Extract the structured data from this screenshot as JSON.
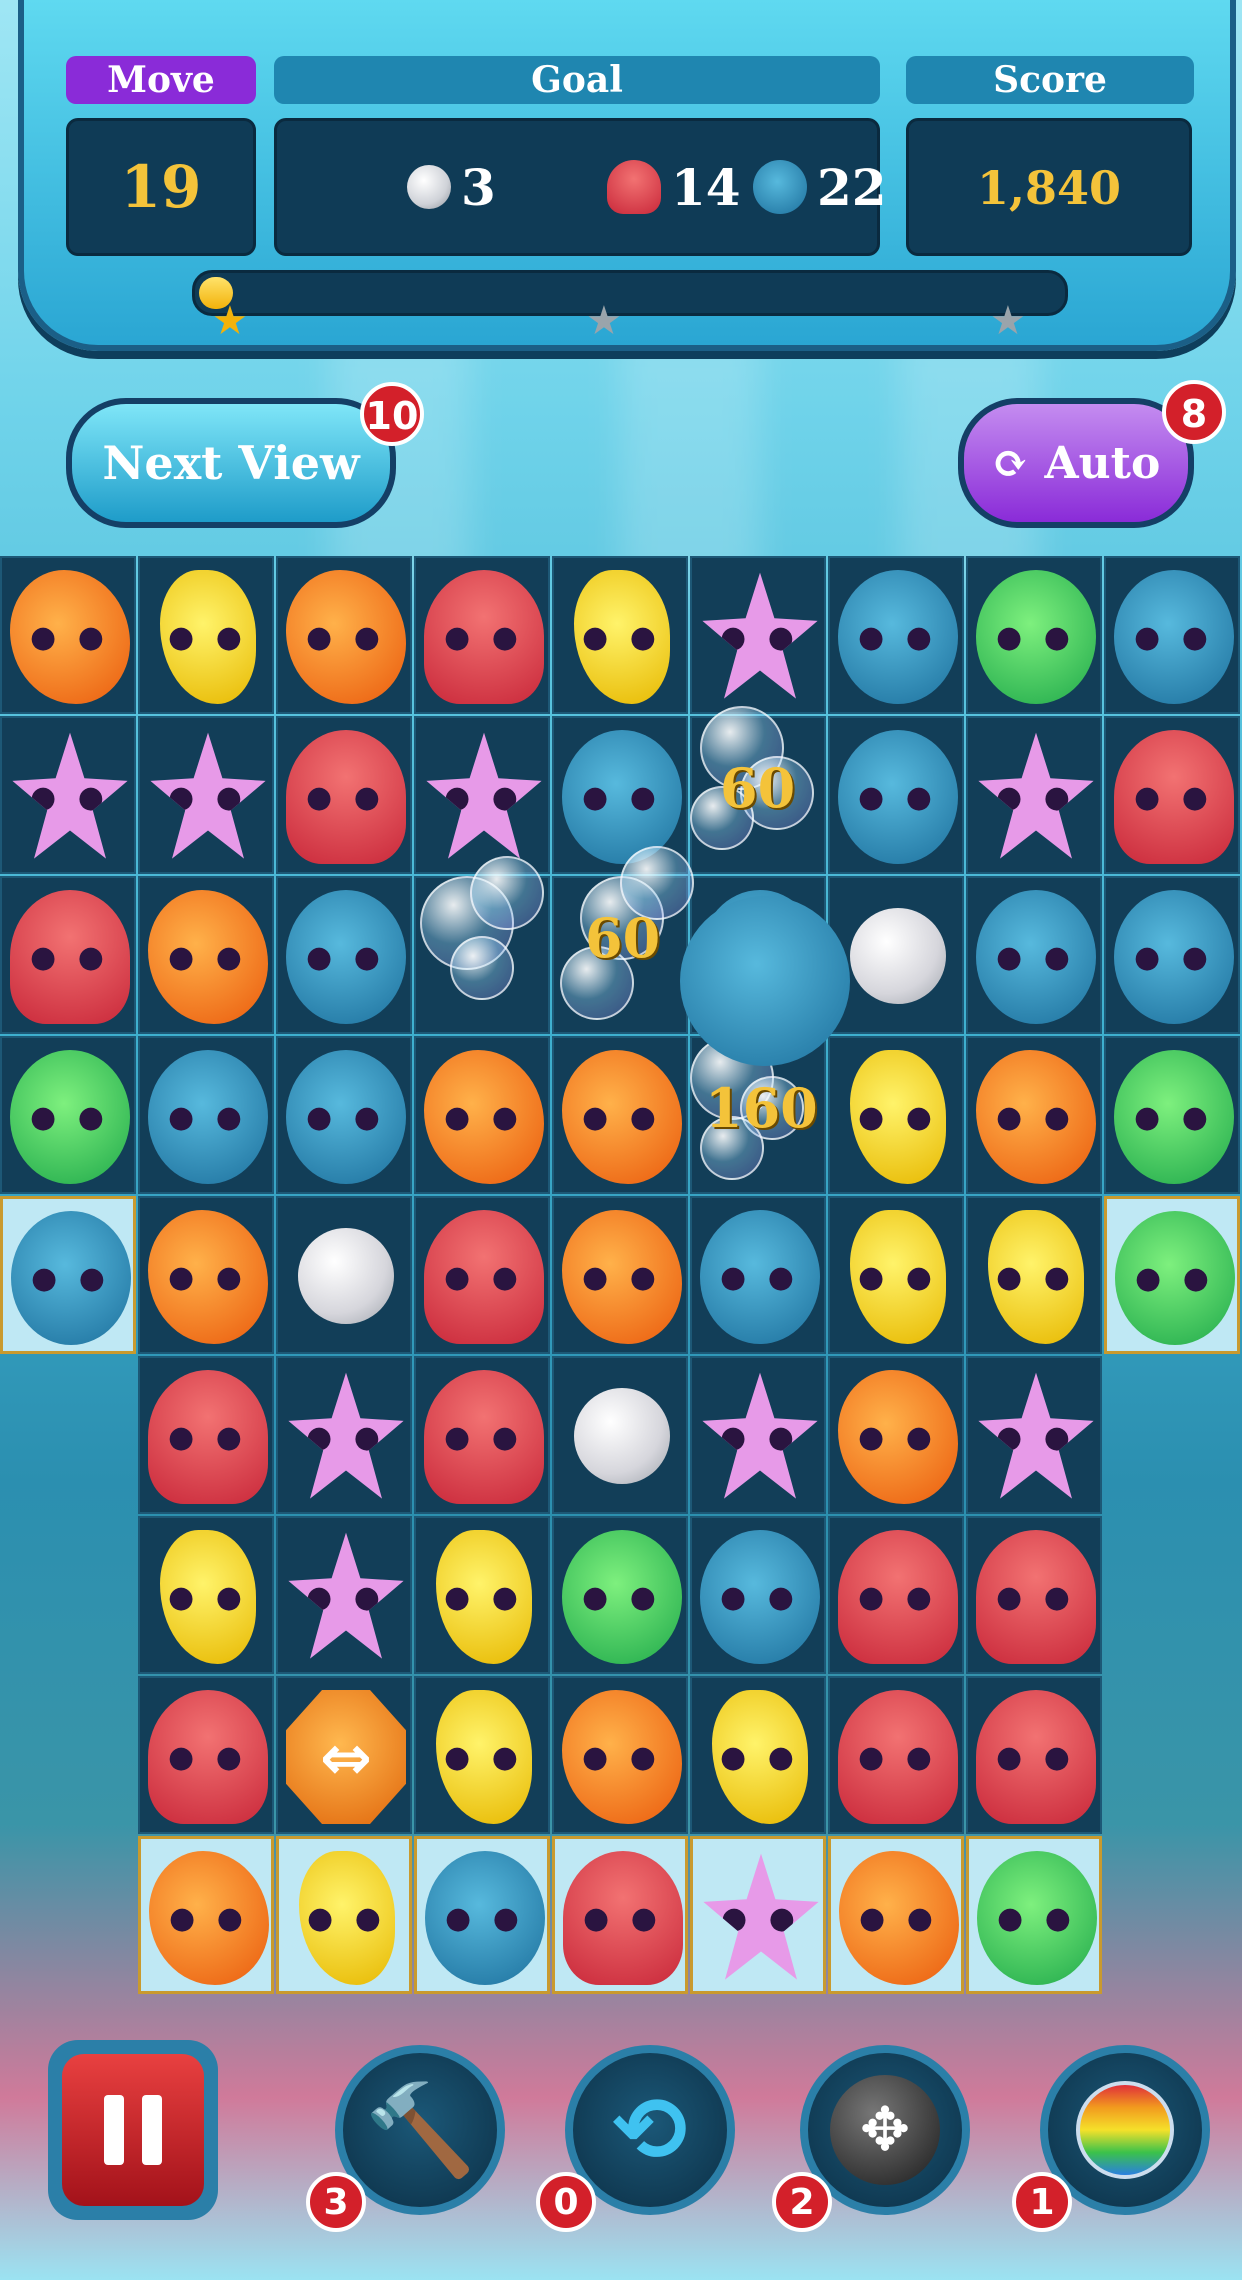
{
  "hud": {
    "move_label": "Move",
    "move_value": "19",
    "goal_label": "Goal",
    "score_label": "Score",
    "score_value": "1,840",
    "goals": [
      {
        "icon": "pearl-icon",
        "count": "3"
      },
      {
        "icon": "octopus-icon",
        "count": "14"
      },
      {
        "icon": "dolphin-icon",
        "count": "22"
      }
    ],
    "progress_fraction": 0.04,
    "colors": {
      "move_tab": "#8a2bd8",
      "move_value": "#f4c33a",
      "score_value": "#f4c33a"
    }
  },
  "buttons": {
    "next_view_label": "Next View",
    "next_view_badge": "10",
    "auto_label": "Auto",
    "auto_badge": "8"
  },
  "board": {
    "rows": [
      [
        "fish",
        "seahorse",
        "fish",
        "octopus",
        "seahorse",
        "star",
        "dolphin",
        "puffer",
        "dolphin"
      ],
      [
        "star",
        "star",
        "octopus",
        "star",
        "dolphin",
        "empty",
        "dolphin",
        "star",
        "octopus"
      ],
      [
        "octopus",
        "fish",
        "dolphin",
        "empty",
        "empty",
        "dolphin",
        "pearl",
        "dolphin",
        "dolphin"
      ],
      [
        "puffer",
        "dolphin",
        "dolphin",
        "fish",
        "fish",
        "empty",
        "seahorse",
        "fish",
        "puffer"
      ],
      [
        "dolphin",
        "fish",
        "pearl",
        "octopus",
        "fish",
        "dolphin",
        "seahorse",
        "seahorse",
        "puffer"
      ],
      [
        "none",
        "octopus",
        "star",
        "octopus",
        "pearl",
        "star",
        "fish",
        "star",
        "none"
      ],
      [
        "none",
        "seahorse",
        "star",
        "seahorse",
        "puffer",
        "dolphin",
        "octopus",
        "octopus",
        "none"
      ],
      [
        "none",
        "octopus",
        "arrow",
        "seahorse",
        "fish",
        "seahorse",
        "octopus",
        "octopus",
        "none"
      ],
      [
        "none",
        "fish",
        "seahorse",
        "dolphin",
        "octopus",
        "star",
        "fish",
        "puffer",
        "none"
      ]
    ],
    "framed_cells": [
      [
        4,
        0
      ],
      [
        4,
        8
      ],
      [
        8,
        1
      ],
      [
        8,
        2
      ],
      [
        8,
        3
      ],
      [
        8,
        4
      ],
      [
        8,
        5
      ],
      [
        8,
        6
      ],
      [
        8,
        7
      ]
    ],
    "floating_scores": [
      "60",
      "60",
      "160"
    ]
  },
  "tools": [
    {
      "name": "pause-button",
      "icon": "pause-icon",
      "badge": ""
    },
    {
      "name": "hammer-tool",
      "icon": "hammer-icon",
      "badge": "3"
    },
    {
      "name": "shuffle-tool",
      "icon": "shuffle-icon",
      "badge": "0"
    },
    {
      "name": "bomb-tool",
      "icon": "bomb-icon",
      "badge": "2"
    },
    {
      "name": "potion-tool",
      "icon": "potion-icon",
      "badge": "1"
    }
  ]
}
